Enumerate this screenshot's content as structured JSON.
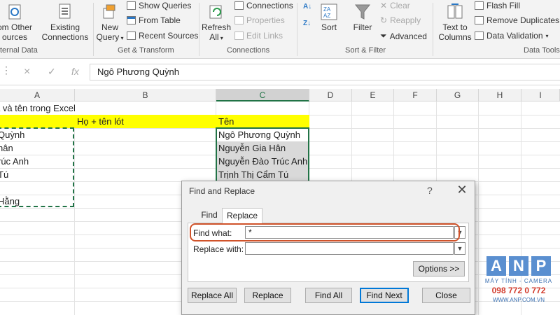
{
  "ribbon": {
    "from_other_sources_label": "om Other",
    "from_other_sources_label2": "ources",
    "existing_connections_label": "Existing",
    "existing_connections_label2": "Connections",
    "new_query_label": "New",
    "new_query_label2": "Query",
    "show_queries": "Show Queries",
    "from_table": "From Table",
    "recent_sources": "Recent Sources",
    "refresh_all_label": "Refresh",
    "refresh_all_label2": "All",
    "connections": "Connections",
    "properties": "Properties",
    "edit_links": "Edit Links",
    "sort": "Sort",
    "filter": "Filter",
    "clear": "Clear",
    "reapply": "Reapply",
    "advanced": "Advanced",
    "text_to_columns_label": "Text to",
    "text_to_columns_label2": "Columns",
    "flash_fill": "Flash Fill",
    "remove_duplicates": "Remove Duplicates",
    "data_validation": "Data Validation",
    "groups": {
      "external_data": "ternal Data",
      "get_transform": "Get & Transform",
      "connections": "Connections",
      "sort_filter": "Sort & Filter",
      "data_tools": "Data Tools"
    }
  },
  "formula_bar": {
    "cancel_icon": "×",
    "enter_icon": "✓",
    "fx": "fx",
    "value": "Ngô Phương Quỳnh"
  },
  "grid": {
    "columns": [
      "A",
      "B",
      "C",
      "D",
      "E",
      "F",
      "G",
      "H",
      "I"
    ],
    "cells": {
      "a1": "ả và tên trong Excel",
      "b2": "Họ + tên lót",
      "c2": "Tên",
      "a3": "Quỳnh",
      "a4": "hân",
      "a5": "rúc Anh",
      "a6": "Tú",
      "a8": "Hằng",
      "c3": "Ngô Phương Quỳnh",
      "c4": "Nguyễn Gia Hân",
      "c5": "Nguyễn Đào Trúc Anh",
      "c6": "Trịnh Thị Cẩm Tú"
    }
  },
  "dialog": {
    "title": "Find and Replace",
    "help": "?",
    "close": "✕",
    "tab_find": "Find",
    "tab_replace": "Replace",
    "find_what_label": "Find what:",
    "find_what_value": "*",
    "replace_with_label": "Replace with:",
    "replace_with_value": "",
    "options_button": "Options >>",
    "replace_all_button": "Replace All",
    "replace_button": "Replace",
    "find_all_button": "Find All",
    "find_next_button": "Find Next",
    "close_button": "Close"
  },
  "logo": {
    "letters": [
      "A",
      "N",
      "P"
    ],
    "line1": "MÁY TÍNH - CAMERA",
    "phone": "098 772 0 772",
    "website": "WWW.ANP.COM.VN"
  },
  "colors": {
    "accent_green": "#217346",
    "highlight_yellow": "#ffff00",
    "highlight_ring": "#d0532a",
    "logo_blue": "#5a8fd0",
    "logo_red": "#d23b2c"
  }
}
